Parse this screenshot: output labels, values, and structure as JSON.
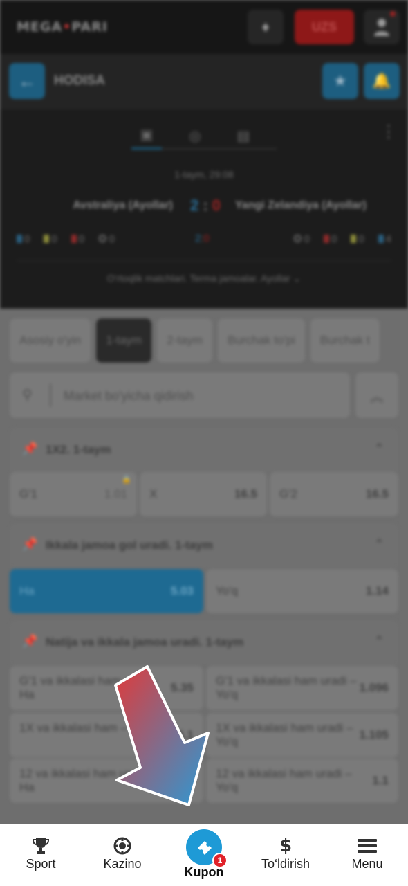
{
  "topbar": {
    "logo_left": "MEGA",
    "logo_dot": "•",
    "logo_right": "PARI",
    "currency": "UZS",
    "diamond_icon": "diamond-icon",
    "user_icon": "user-icon"
  },
  "event": {
    "title": "HODISA"
  },
  "scoreboard": {
    "time": "1-taym, 29:08",
    "team1": "Avstraliya (Ayollar)",
    "team2": "Yangi Zelandiya (Ayollar)",
    "score1": "2",
    "score2": "0",
    "stats_left": [
      "0",
      "0",
      "0",
      "0"
    ],
    "stats_right": [
      "0",
      "0",
      "0",
      "4"
    ],
    "mid_score1": "2",
    "mid_score2": "0",
    "league": "O‘rtoqlik matchlari. Terma jamoalar. Ayollar"
  },
  "chips": [
    "Asosiy o'yin",
    "1-taym",
    "2-taym",
    "Burchak to'pi",
    "Burchak t"
  ],
  "search": {
    "placeholder": "Market bo'yicha qidirish"
  },
  "markets": [
    {
      "title": "1X2. 1-taym",
      "odds": [
        {
          "label": "G'1",
          "value": "1.01"
        },
        {
          "label": "X",
          "value": "16.5"
        },
        {
          "label": "G'2",
          "value": "16.5"
        }
      ]
    },
    {
      "title": "Ikkala jamoa gol uradi. 1-taym",
      "odds": [
        {
          "label": "Ha",
          "value": "5.03"
        },
        {
          "label": "Yo'q",
          "value": "1.14"
        }
      ]
    },
    {
      "title": "Natija va ikkala jamoa uradi. 1-taym",
      "odds": [
        {
          "label": "G'1 va ikkalasi ham uradi - Ha",
          "value": "5.35"
        },
        {
          "label": "G'1 va ikkalasi ham uradi – Yo'q",
          "value": "1.096"
        },
        {
          "label": "1X va ikkalasi ham – Ha",
          "value": "5.1"
        },
        {
          "label": "1X va ikkalasi ham uradi – Yo'q",
          "value": "1.105"
        },
        {
          "label": "12 va ikkalasi ham uradi – Ha",
          "value": "5.1"
        },
        {
          "label": "12 va ikkalasi ham uradi – Yo'q",
          "value": "1.1"
        }
      ]
    }
  ],
  "nav": {
    "sport": "Sport",
    "kazino": "Kazino",
    "kupon": "Kupon",
    "kupon_badge": "1",
    "toldirish": "To‘ldirish",
    "menu": "Menu"
  },
  "colors": {
    "accent": "#1e9ad6",
    "badge": "#e1222a",
    "arrow_top": "#e03a3a",
    "arrow_bottom": "#2a9ad6"
  }
}
